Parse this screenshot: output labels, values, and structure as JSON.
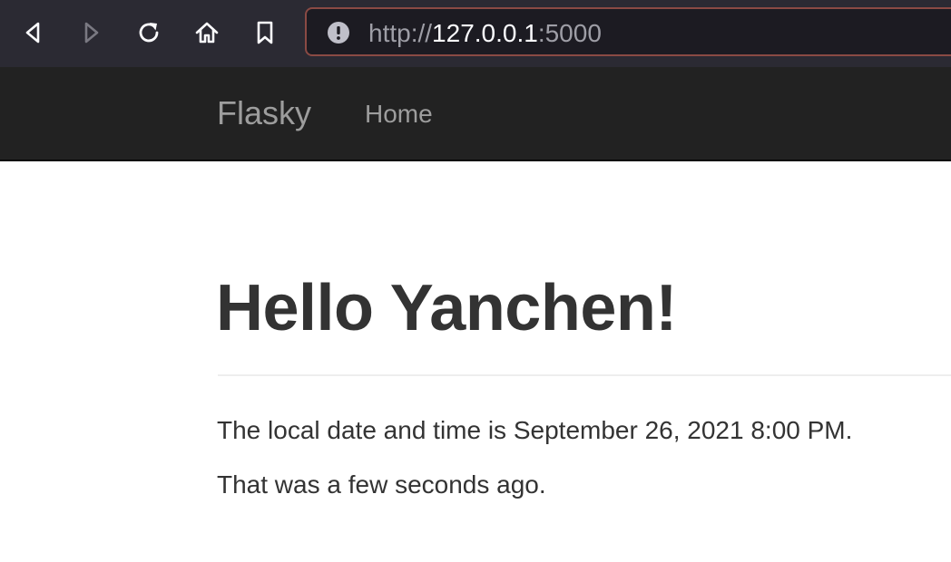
{
  "browser": {
    "url_scheme": "http://",
    "url_host": "127.0.0.1",
    "url_port": ":5000",
    "icons": {
      "back": "back-arrow-icon",
      "forward": "forward-arrow-icon",
      "reload": "reload-icon",
      "home": "home-icon",
      "bookmark": "bookmark-icon",
      "site_info": "insecure-warning-icon"
    },
    "colors": {
      "toolbar_bg": "#2b2a33",
      "urlbar_bg": "#1c1b22",
      "urlbar_border": "#8a4a44"
    }
  },
  "navbar": {
    "brand": "Flasky",
    "links": [
      {
        "label": "Home"
      }
    ],
    "colors": {
      "bg": "#222222",
      "text": "#9d9d9d"
    }
  },
  "main": {
    "title": "Hello Yanchen!",
    "paragraphs": [
      "The local date and time is September 26, 2021 8:00 PM.",
      "That was a few seconds ago."
    ],
    "colors": {
      "text": "#333333"
    }
  }
}
